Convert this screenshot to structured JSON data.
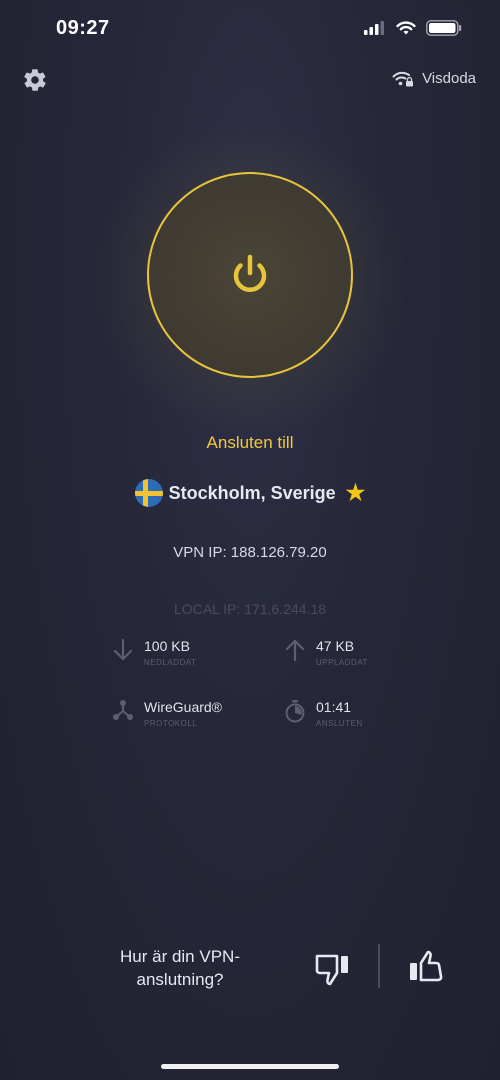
{
  "status_bar": {
    "time": "09:27"
  },
  "header": {
    "network_name": "Visdoda"
  },
  "connection": {
    "status_label": "Ansluten till",
    "location": "Stockholm, Sverige",
    "vpn_ip": "VPN IP: 188.126.79.20",
    "local_ip": "LOCAL IP: 171.6.244.18"
  },
  "stats": {
    "download": {
      "value": "100 KB",
      "label": "NEDLADDAT"
    },
    "upload": {
      "value": "47 KB",
      "label": "UPPLADDAT"
    },
    "protocol": {
      "value": "WireGuard®",
      "label": "PROTOKOLL"
    },
    "duration": {
      "value": "01:41",
      "label": "ANSLUTEN"
    }
  },
  "feedback": {
    "question": "Hur är din VPN-anslutning?"
  },
  "colors": {
    "accent": "#e8c43c",
    "background": "#262739"
  }
}
